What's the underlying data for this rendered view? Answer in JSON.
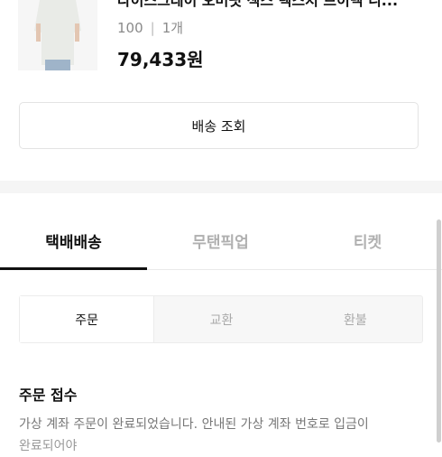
{
  "product": {
    "name": "다이스그레이 오버핏 섹스 텍스처 브이넥 니...",
    "size": "100",
    "quantity": "1개",
    "price": "79,433원"
  },
  "actions": {
    "track_delivery": "배송 조회"
  },
  "delivery_tabs": [
    {
      "label": "택배배송",
      "active": true
    },
    {
      "label": "무탠픽업",
      "active": false
    },
    {
      "label": "티켓",
      "active": false
    }
  ],
  "order_tabs": [
    {
      "label": "주문",
      "active": true
    },
    {
      "label": "교환",
      "active": false
    },
    {
      "label": "환불",
      "active": false
    }
  ],
  "status": {
    "title": "주문 접수",
    "body": "가상 계좌 주문이 완료되었습니다. 안내된 가상 계좌 번호로 입금이",
    "body_next": "완료되어야"
  },
  "colors": {
    "accent": "#111111",
    "muted": "#b0b0b0"
  }
}
